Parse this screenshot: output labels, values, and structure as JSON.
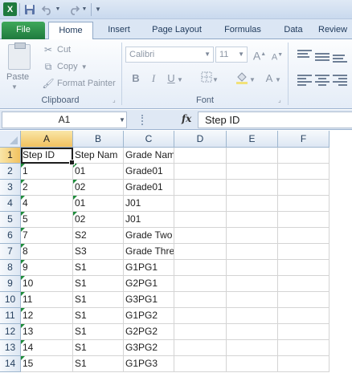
{
  "quick_access": {
    "logo_text": "X",
    "icons": [
      "excel-logo-icon",
      "save-icon",
      "undo-icon",
      "redo-icon",
      "customize-qat-icon"
    ]
  },
  "tabs": [
    {
      "label": "File"
    },
    {
      "label": "Home"
    },
    {
      "label": "Insert"
    },
    {
      "label": "Page Layout"
    },
    {
      "label": "Formulas"
    },
    {
      "label": "Data"
    },
    {
      "label": "Review"
    }
  ],
  "ribbon": {
    "clipboard": {
      "paste": "Paste",
      "cut": "Cut",
      "copy": "Copy",
      "format_painter": "Format Painter",
      "label": "Clipboard"
    },
    "font": {
      "name": "Calibri",
      "size": "11",
      "label": "Font",
      "bold": "B",
      "italic": "I",
      "underline": "U",
      "grow": "A",
      "shrink": "A",
      "color": "A"
    }
  },
  "formula_bar": {
    "name_box": "A1",
    "fx": "fx",
    "content": "Step ID"
  },
  "grid": {
    "columns": [
      "A",
      "B",
      "C",
      "D",
      "E",
      "F"
    ],
    "selected_column": "A",
    "selected_row": "1",
    "rows": [
      {
        "num": "1",
        "cells": [
          "Step ID",
          "Step Nam",
          "Grade Name",
          "",
          "",
          ""
        ],
        "err": [
          false,
          false,
          false
        ]
      },
      {
        "num": "2",
        "cells": [
          "1",
          "01",
          "Grade01",
          "",
          "",
          ""
        ],
        "err": [
          true,
          true,
          false
        ]
      },
      {
        "num": "3",
        "cells": [
          "2",
          "02",
          "Grade01",
          "",
          "",
          ""
        ],
        "err": [
          true,
          true,
          false
        ]
      },
      {
        "num": "4",
        "cells": [
          "4",
          "01",
          "J01",
          "",
          "",
          ""
        ],
        "err": [
          true,
          true,
          false
        ]
      },
      {
        "num": "5",
        "cells": [
          "5",
          "02",
          "J01",
          "",
          "",
          ""
        ],
        "err": [
          true,
          true,
          false
        ]
      },
      {
        "num": "6",
        "cells": [
          "7",
          "S2",
          "Grade Two",
          "",
          "",
          ""
        ],
        "err": [
          true,
          false,
          false
        ]
      },
      {
        "num": "7",
        "cells": [
          "8",
          "S3",
          "Grade Three",
          "",
          "",
          ""
        ],
        "err": [
          true,
          false,
          false
        ]
      },
      {
        "num": "8",
        "cells": [
          "9",
          "S1",
          "G1PG1",
          "",
          "",
          ""
        ],
        "err": [
          true,
          false,
          false
        ]
      },
      {
        "num": "9",
        "cells": [
          "10",
          "S1",
          "G2PG1",
          "",
          "",
          ""
        ],
        "err": [
          true,
          false,
          false
        ]
      },
      {
        "num": "10",
        "cells": [
          "11",
          "S1",
          "G3PG1",
          "",
          "",
          ""
        ],
        "err": [
          true,
          false,
          false
        ]
      },
      {
        "num": "11",
        "cells": [
          "12",
          "S1",
          "G1PG2",
          "",
          "",
          ""
        ],
        "err": [
          true,
          false,
          false
        ]
      },
      {
        "num": "12",
        "cells": [
          "13",
          "S1",
          "G2PG2",
          "",
          "",
          ""
        ],
        "err": [
          true,
          false,
          false
        ]
      },
      {
        "num": "13",
        "cells": [
          "14",
          "S1",
          "G3PG2",
          "",
          "",
          ""
        ],
        "err": [
          true,
          false,
          false
        ]
      },
      {
        "num": "14",
        "cells": [
          "15",
          "S1",
          "G1PG3",
          "",
          "",
          ""
        ],
        "err": [
          true,
          false,
          false
        ]
      }
    ]
  }
}
